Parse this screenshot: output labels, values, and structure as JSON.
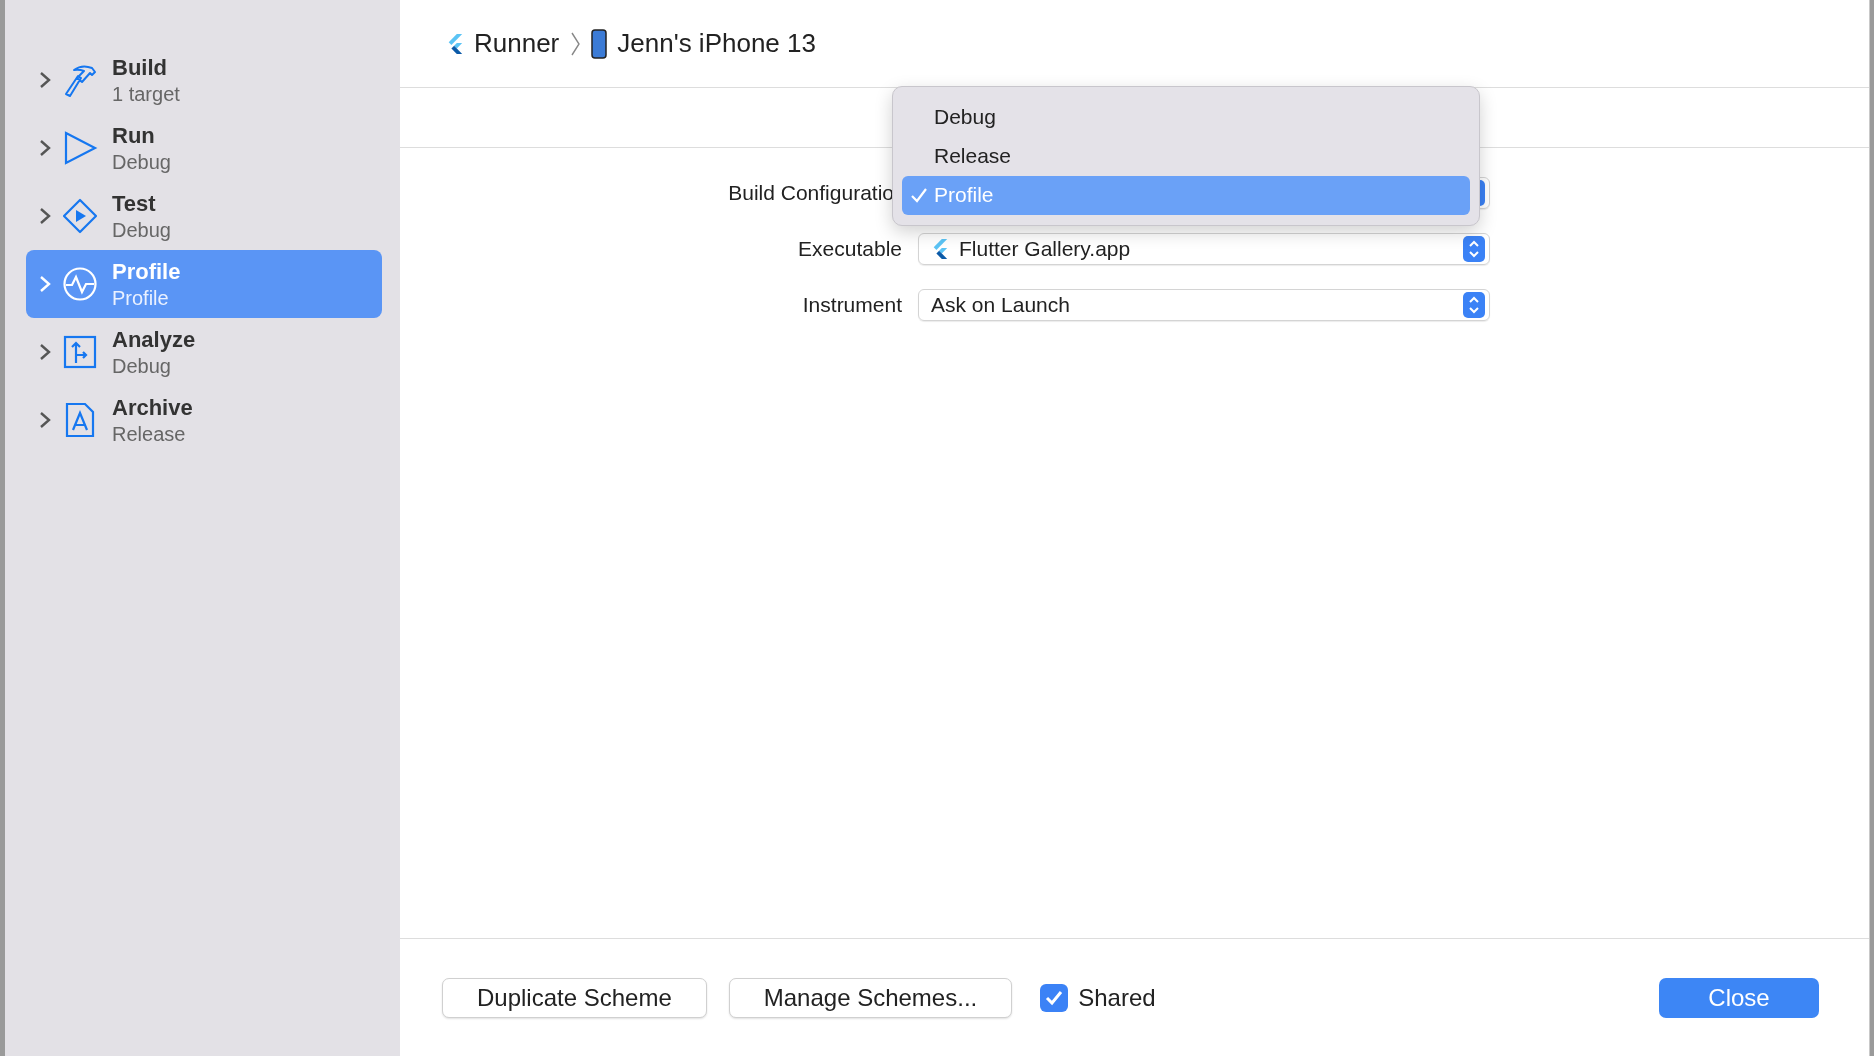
{
  "breadcrumb": [
    {
      "label": "Runner",
      "kind": "project"
    },
    {
      "label": "Jenn's iPhone 13",
      "kind": "device"
    }
  ],
  "sidebar": {
    "items": [
      {
        "title": "Build",
        "subtitle": "1 target",
        "kind": "build",
        "selected": false,
        "expanded": false
      },
      {
        "title": "Run",
        "subtitle": "Debug",
        "kind": "run",
        "selected": false,
        "expanded": false
      },
      {
        "title": "Test",
        "subtitle": "Debug",
        "kind": "test",
        "selected": false,
        "expanded": false
      },
      {
        "title": "Profile",
        "subtitle": "Profile",
        "kind": "profile",
        "selected": true,
        "expanded": false
      },
      {
        "title": "Analyze",
        "subtitle": "Debug",
        "kind": "analyze",
        "selected": false,
        "expanded": false
      },
      {
        "title": "Archive",
        "subtitle": "Release",
        "kind": "archive",
        "selected": false,
        "expanded": false
      }
    ]
  },
  "form": {
    "rows": [
      {
        "label": "Build Configuratio",
        "kind": "covered"
      },
      {
        "label": "Executable",
        "value": "Flutter Gallery.app",
        "kind": "app"
      },
      {
        "label": "Instrument",
        "value": "Ask on Launch",
        "kind": "plain"
      }
    ]
  },
  "menu": {
    "options": [
      {
        "label": "Debug",
        "selected": false
      },
      {
        "label": "Release",
        "selected": false
      },
      {
        "label": "Profile",
        "selected": true
      }
    ]
  },
  "footer": {
    "buttons": [
      "Duplicate Scheme",
      "Manage Schemes..."
    ],
    "shared": {
      "label": "Shared",
      "checked": true
    },
    "close": "Close"
  }
}
